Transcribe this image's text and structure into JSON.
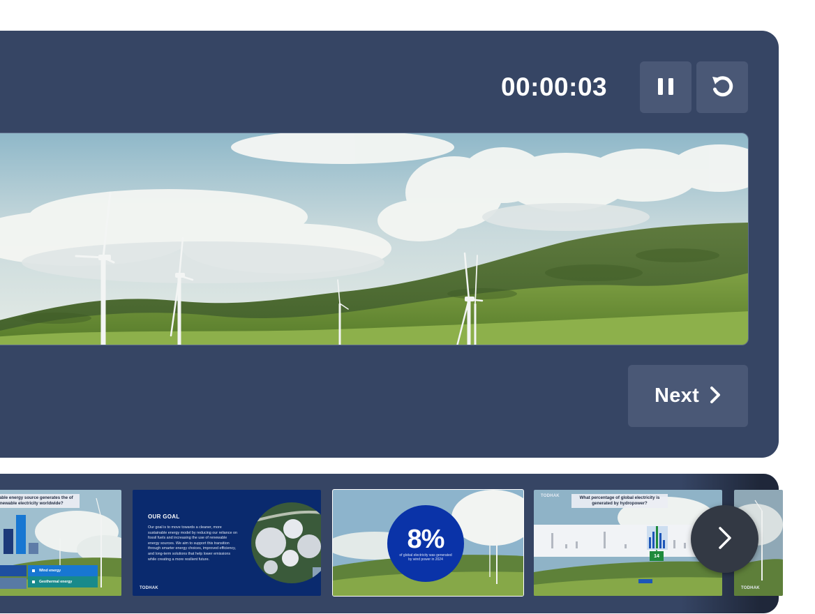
{
  "presenter": {
    "timer": "00:00:03",
    "next_label": "Next",
    "icons": {
      "pause": "pause-icon",
      "restart": "restart-icon",
      "next": "chevron-right-icon"
    }
  },
  "filmstrip": {
    "slides": [
      {
        "question": "wable energy source generates the\nof renewable electricity worldwide?",
        "options": [
          "Wind energy",
          "Geothermal energy"
        ]
      },
      {
        "title": "OUR GOAL",
        "body": "Our goal is to move towards a cleaner, more sustainable energy model by reducing our reliance on fossil fuels and increasing the use of renewable energy sources. We aim to support this transition through smarter energy choices, improved efficiency, and long-term solutions that help lower emissions while creating a more resilient future.",
        "brand": "TODHAK"
      },
      {
        "stat": "8%",
        "caption": "of global electricity was generated by wind power in 2024"
      },
      {
        "brand": "TODHAK",
        "question": "What percentage of global electricity is generated by hydropower?",
        "slider_value": "14"
      },
      {
        "brand": "TODHAK"
      }
    ],
    "next_icon": "chevron-right-icon"
  },
  "colors": {
    "panel": "#364564",
    "button": "#4a5876",
    "slide_blue": "#0a2a6e",
    "stat_circle": "#0a33a8"
  }
}
